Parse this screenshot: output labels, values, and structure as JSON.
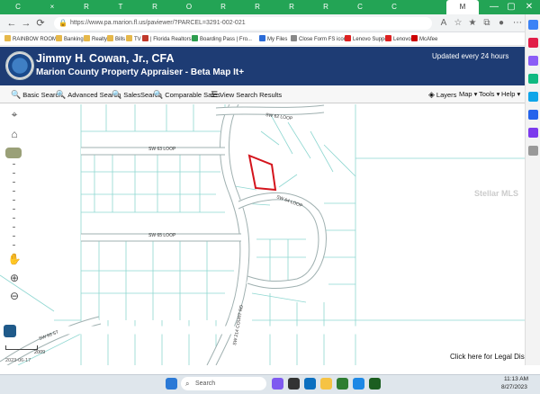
{
  "browser": {
    "tabs": [
      "C",
      "×",
      "R",
      "T",
      "R",
      "O",
      "R",
      "R",
      "R",
      "R",
      "C",
      "C"
    ],
    "active_tab_label": "M",
    "window_controls": [
      "—",
      "▢",
      "✕"
    ],
    "url": "https://www.pa.marion.fl.us/paviewer/?PARCEL=3291-002-021",
    "bookmarks": [
      "RAINBOW ROOM...",
      "Banking",
      "Realty",
      "Bills",
      "TV",
      "| Florida Realtors",
      "Boarding Pass | Fro...",
      "My Files",
      "Close Form FS icon...",
      "Lenovo Support",
      "Lenovo",
      "McAfee"
    ]
  },
  "site": {
    "title": "Jimmy H. Cowan, Jr., CFA",
    "subtitle": "Marion County Property Appraiser - Beta Map It+",
    "updated": "Updated every 24 hours"
  },
  "toolbar": {
    "basic_search": "Basic Search",
    "advanced_search": "Advanced Search",
    "sales_search": "SalesSearch",
    "comparable_sales": "Comparable Sales",
    "view_results": "View Search Results",
    "layers": "Layers",
    "map": "Map",
    "tools": "Tools",
    "help": "Help"
  },
  "map": {
    "labels": {
      "loop62": "SW 62 LOOP",
      "loop63": "SW 63 LOOP",
      "loop64": "SW 64 LOOP",
      "loop65": "SW 65 LOOP",
      "road214": "SW 214 COURT RD",
      "road69": "SW 69 ST"
    },
    "scale_label": "2009",
    "scale_date": "2023-06-17",
    "legal": "Click here for Legal Disclaimer",
    "selected_parcel_color": "#d4141c"
  },
  "watermark": "Stellar MLS",
  "taskbar": {
    "search_placeholder": "Search",
    "time": "11:13 AM",
    "date": "8/27/2023"
  }
}
